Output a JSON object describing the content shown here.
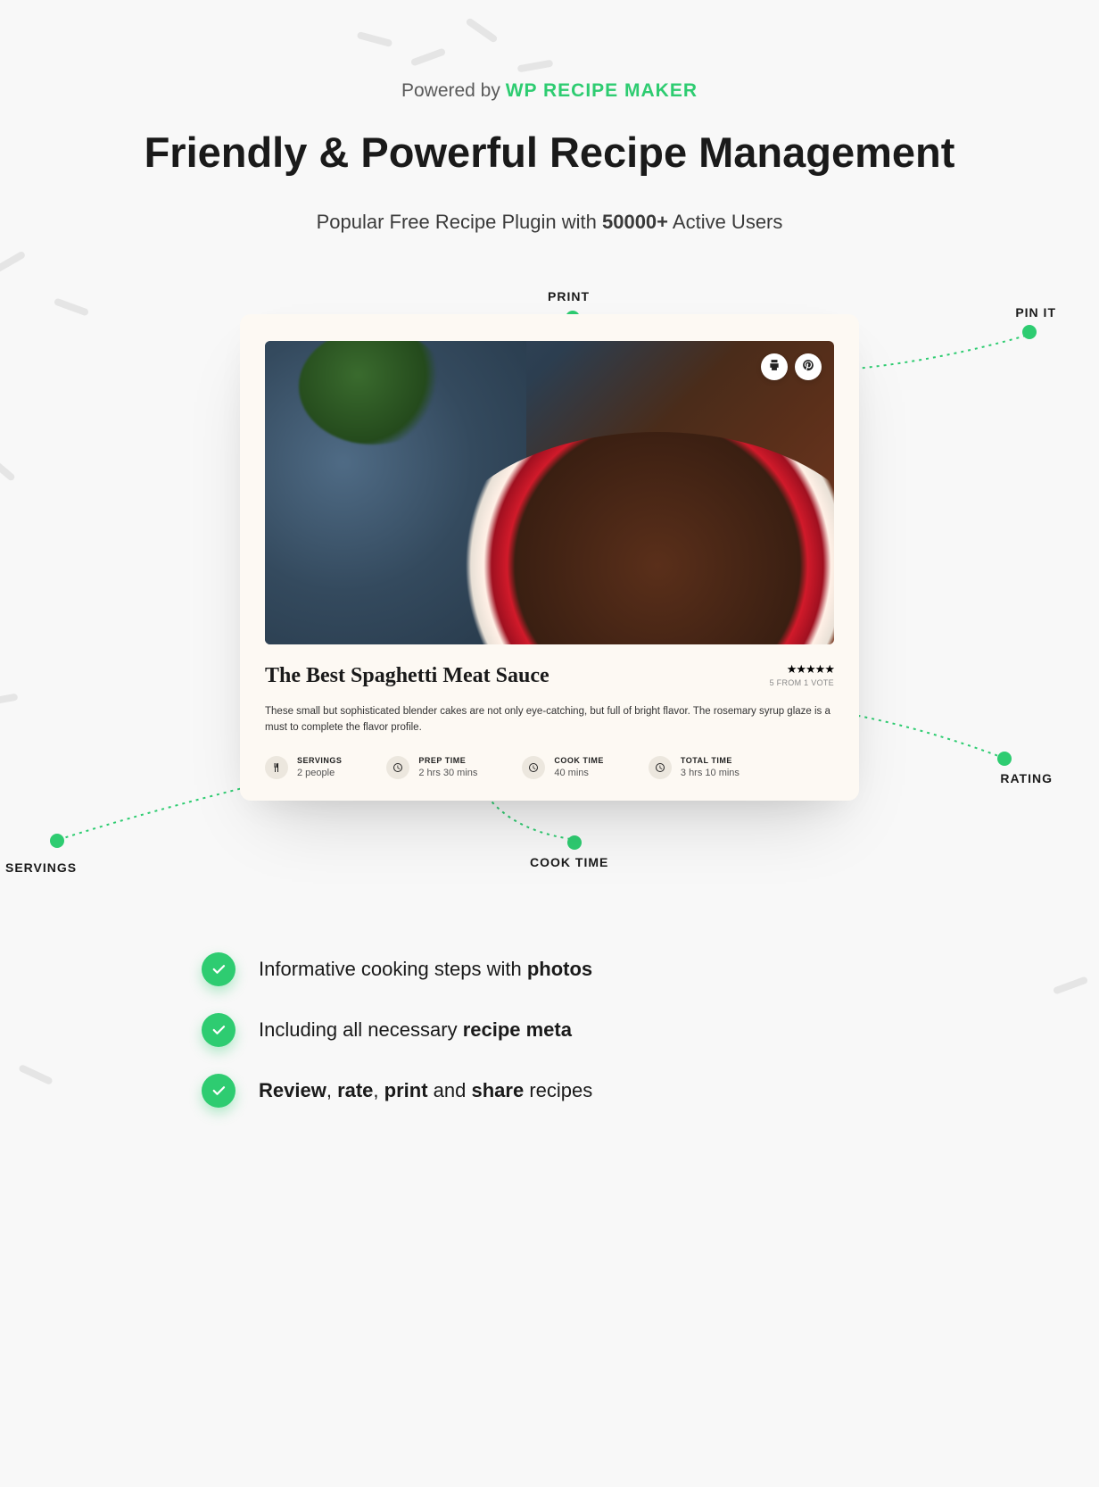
{
  "header": {
    "powered_prefix": "Powered by ",
    "brand": "WP RECIPE MAKER",
    "title": "Friendly & Powerful Recipe Management",
    "subtitle_before": "Popular Free Recipe Plugin with ",
    "subtitle_bold": "50000+",
    "subtitle_after": " Active Users"
  },
  "callouts": {
    "print": "PRINT",
    "pinit": "PIN IT",
    "rating": "RATING",
    "cooktime": "COOK TIME",
    "servings": "SERVINGS"
  },
  "recipe": {
    "title": "The Best Spaghetti Meat Sauce",
    "description": "These small but sophisticated blender cakes are not only eye-catching, but full of bright flavor. The rosemary syrup glaze is a must to complete the flavor profile.",
    "rating_stars": "★★★★★",
    "rating_text": "5 FROM 1 VOTE",
    "meta": [
      {
        "label": "SERVINGS",
        "value": "2 people",
        "icon": "utensils"
      },
      {
        "label": "PREP TIME",
        "value": "2 hrs 30 mins",
        "icon": "clock"
      },
      {
        "label": "COOK TIME",
        "value": "40 mins",
        "icon": "clock"
      },
      {
        "label": "TOTAL TIME",
        "value": "3 hrs 10 mins",
        "icon": "clock"
      }
    ]
  },
  "features": [
    {
      "before": "Informative cooking steps with ",
      "bold": "photos",
      "after": ""
    },
    {
      "before": "Including all necessary ",
      "bold": "recipe meta",
      "after": ""
    },
    {
      "before": "",
      "bold_parts": [
        "Review",
        ", ",
        "rate",
        ", ",
        "print",
        " and ",
        "share"
      ],
      "after": " recipes"
    }
  ],
  "colors": {
    "accent": "#2ecc71"
  }
}
